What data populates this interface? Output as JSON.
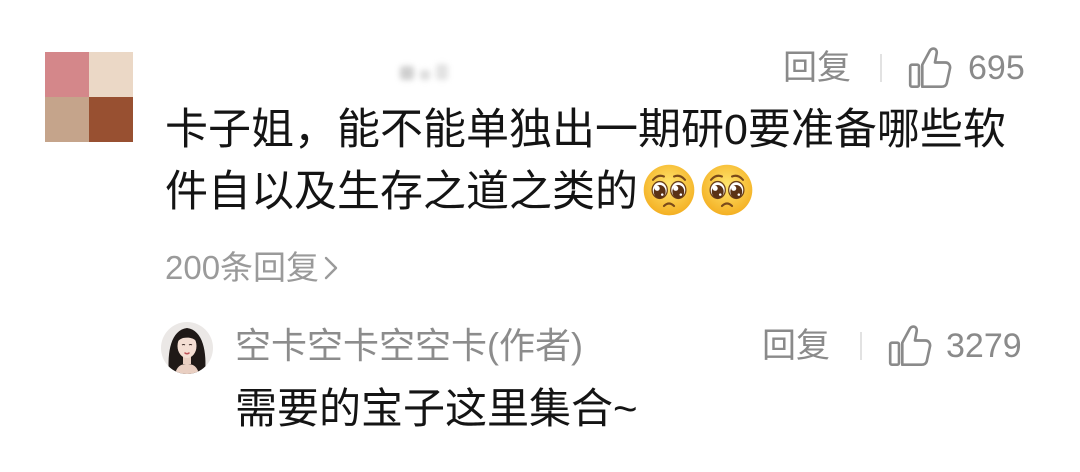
{
  "comment": {
    "avatar_colors": [
      "#d4878a",
      "#ebd8c6",
      "#c5a48b",
      "#985031"
    ],
    "reply_label": "回复",
    "like_icon": "thumbs-up-icon",
    "like_count": "695",
    "text": "卡子姐，能不能单独出一期研0要准备哪些软件自以及生存之道之类的",
    "emojis": [
      "pleading-face",
      "pleading-face"
    ],
    "replies_link": "200条回复",
    "replies_link_icon": "chevron-right-icon"
  },
  "reply": {
    "author": "空卡空卡空空卡(作者)",
    "reply_label": "回复",
    "like_icon": "thumbs-up-icon",
    "like_count": "3279",
    "text": "需要的宝子这里集合~"
  },
  "colors": {
    "text_primary": "#141414",
    "text_secondary": "#8a8a8a",
    "divider": "#e2e2e2",
    "background": "#ffffff"
  }
}
